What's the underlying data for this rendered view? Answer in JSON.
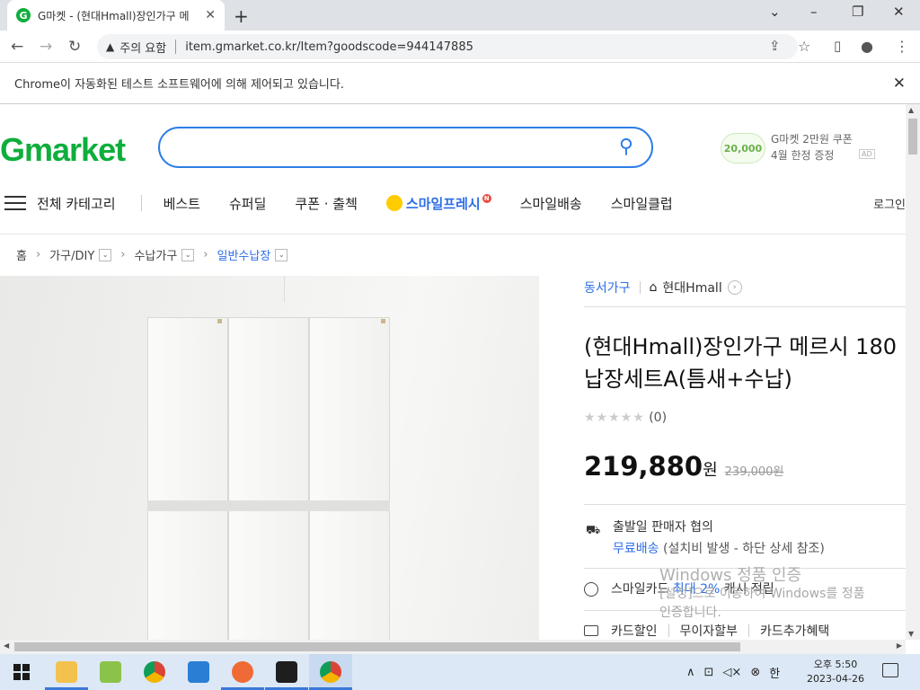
{
  "browser": {
    "tab_title": "G마켓 - (현대Hmall)장인가구 메",
    "favicon_letter": "G",
    "new_tab": "+",
    "window_controls": {
      "minimize": "–",
      "restore": "❐",
      "close": "✕",
      "tabsearch": "⌄"
    },
    "security_label": "주의 요함",
    "url": "item.gmarket.co.kr/Item?goodscode=944147885",
    "infobar_text": "Chrome이 자동화된 테스트 소프트웨어에 의해 제어되고 있습니다."
  },
  "header": {
    "logo_g": "G",
    "logo_rest": "market",
    "search_placeholder": "",
    "coupon_badge": "20,000",
    "coupon_line1": "G마켓 2만원 쿠폰",
    "coupon_line2": "4월 한정 증정",
    "coupon_ad": "AD"
  },
  "nav": {
    "all_categories": "전체 카테고리",
    "items": [
      "베스트",
      "슈퍼딜",
      "쿠폰 · 출첵"
    ],
    "smile_fresh": "스마일프레시",
    "smile_badge": "N",
    "items2": [
      "스마일배송",
      "스마일클럽"
    ],
    "login": "로그인"
  },
  "breadcrumb": {
    "home": "홈",
    "levels": [
      "가구/DIY",
      "수납가구",
      "일반수납장"
    ],
    "dropdown_glyph": "⌄"
  },
  "product": {
    "seller_category": "동서가구",
    "store": "현대Hmall",
    "title_line1": "(현대Hmall)장인가구 메르시 180",
    "title_line2": "납장세트A(틈새+수납)",
    "stars": "★★★★★",
    "review_count": "(0)",
    "price": "219,880",
    "price_unit": "원",
    "original_price": "239,000원",
    "ship_line1": "출발일 판매자 협의",
    "ship_free": "무료배송",
    "ship_note": "(설치비 발생 - 하단 상세 참조)",
    "card_prefix": "스마일카드",
    "card_rate": "최대 2%",
    "card_suffix": "캐시 적립",
    "benefits": [
      "카드할인",
      "무이자할부",
      "카드추가혜택"
    ]
  },
  "watermark": {
    "title": "Windows 정품 인증",
    "line1": "[설정]으로 이동하여 Windows를 정품",
    "line2": "인증합니다."
  },
  "taskbar": {
    "tray_ime": "한",
    "time": "오후 5:50",
    "date": "2023-04-26"
  }
}
